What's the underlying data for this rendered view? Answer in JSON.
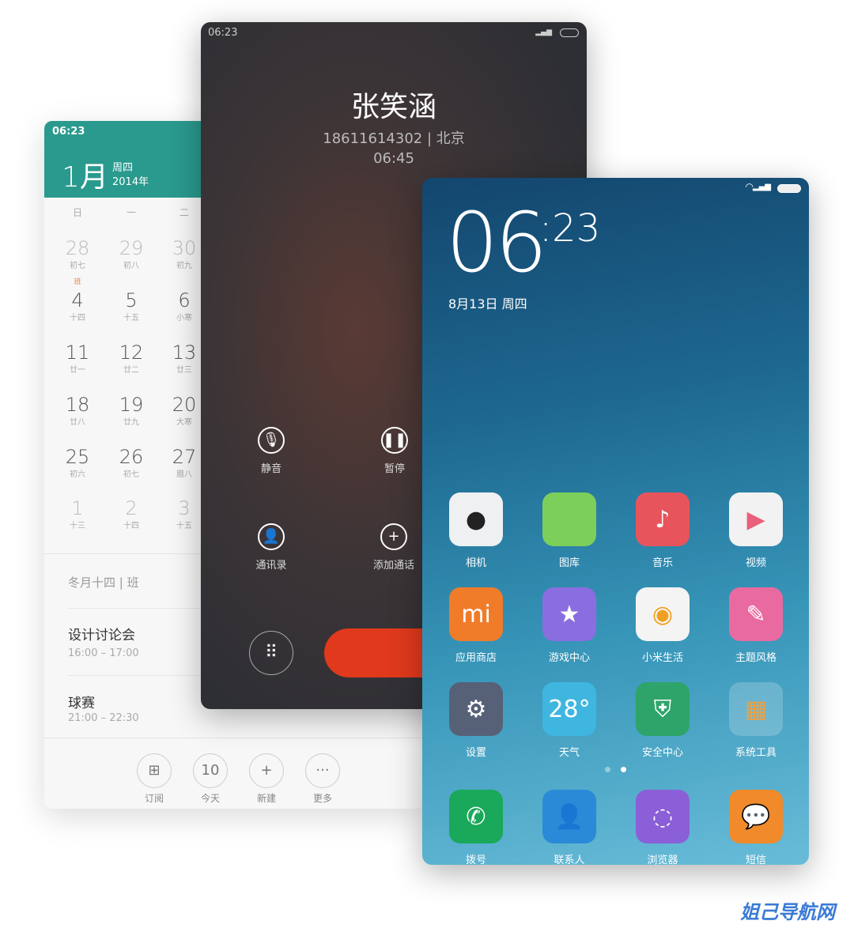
{
  "calendar": {
    "status_time": "06:23",
    "month": "1月",
    "weekday": "周四",
    "year": "2014年",
    "weekdays": [
      "日",
      "一",
      "二"
    ],
    "rows": [
      [
        {
          "d": "28",
          "l": "初七",
          "dim": true
        },
        {
          "d": "29",
          "l": "初八",
          "dim": true
        },
        {
          "d": "30",
          "l": "初九",
          "dim": true
        }
      ],
      [
        {
          "d": "4",
          "l": "十四",
          "badge": "班"
        },
        {
          "d": "5",
          "l": "十五"
        },
        {
          "d": "6",
          "l": "小寒"
        }
      ],
      [
        {
          "d": "11",
          "l": "廿一"
        },
        {
          "d": "12",
          "l": "廿二"
        },
        {
          "d": "13",
          "l": "廿三"
        }
      ],
      [
        {
          "d": "18",
          "l": "廿八"
        },
        {
          "d": "19",
          "l": "廿九"
        },
        {
          "d": "20",
          "l": "大寒"
        }
      ],
      [
        {
          "d": "25",
          "l": "初六"
        },
        {
          "d": "26",
          "l": "初七"
        },
        {
          "d": "27",
          "l": "腊八"
        }
      ],
      [
        {
          "d": "1",
          "l": "十三",
          "dim": true
        },
        {
          "d": "2",
          "l": "十四",
          "dim": true
        },
        {
          "d": "3",
          "l": "十五",
          "dim": true
        }
      ]
    ],
    "lunar_info": "冬月十四 | 班",
    "events": [
      {
        "title": "设计讨论会",
        "time": "16:00 – 17:00"
      },
      {
        "title": "球赛",
        "time": "21:00 – 22:30"
      }
    ],
    "toolbar": [
      {
        "icon": "grid-icon",
        "glyph": "⊞",
        "label": "订阅"
      },
      {
        "icon": "today-icon",
        "glyph": "10",
        "label": "今天"
      },
      {
        "icon": "plus-icon",
        "glyph": "+",
        "label": "新建"
      },
      {
        "icon": "more-icon",
        "glyph": "···",
        "label": "更多"
      }
    ]
  },
  "call": {
    "status_time": "06:23",
    "name": "张笑涵",
    "number_location": "18611614302 | 北京",
    "duration": "06:45",
    "buttons": [
      {
        "icon": "microphone-icon",
        "glyph": "🎙",
        "label": "静音"
      },
      {
        "icon": "pause-icon",
        "glyph": "❚❚",
        "label": "暂停"
      },
      {
        "icon": "contact-icon",
        "glyph": "👤",
        "label": "通讯录"
      },
      {
        "icon": "add-call-icon",
        "glyph": "+",
        "label": "添加通话"
      }
    ],
    "end_color": "#e0391c"
  },
  "home": {
    "clock_hour": "06",
    "clock_minute": ":23",
    "date": "8月13日 周四",
    "apps": [
      {
        "label": "相机",
        "icon": "camera-icon",
        "bg": "#eef0f2",
        "glyph": "●",
        "fg": "#222"
      },
      {
        "label": "图库",
        "icon": "gallery-icon",
        "bg": "#7ccf5a",
        "glyph": "",
        "fg": "#fff"
      },
      {
        "label": "音乐",
        "icon": "music-icon",
        "bg": "#e8545c",
        "glyph": "♪",
        "fg": "#fff"
      },
      {
        "label": "视频",
        "icon": "video-icon",
        "bg": "#f2f2f2",
        "glyph": "▶",
        "fg": "#e9607a"
      },
      {
        "label": "应用商店",
        "icon": "app-store-icon",
        "bg": "#f07c2a",
        "glyph": "mi",
        "fg": "#fff"
      },
      {
        "label": "游戏中心",
        "icon": "game-center-icon",
        "bg": "#8a6ee0",
        "glyph": "★",
        "fg": "#fff"
      },
      {
        "label": "小米生活",
        "icon": "mi-life-icon",
        "bg": "#f4f4f4",
        "glyph": "◉",
        "fg": "#f0a020"
      },
      {
        "label": "主题风格",
        "icon": "theme-icon",
        "bg": "#e96aa0",
        "glyph": "✎",
        "fg": "#fff"
      },
      {
        "label": "设置",
        "icon": "settings-icon",
        "bg": "#566178",
        "glyph": "⚙",
        "fg": "#fff"
      },
      {
        "label": "天气",
        "icon": "weather-icon",
        "bg": "#3fb6e0",
        "glyph": "28°",
        "fg": "#fff"
      },
      {
        "label": "安全中心",
        "icon": "security-icon",
        "bg": "#2ea46a",
        "glyph": "⛨",
        "fg": "#fff"
      },
      {
        "label": "系统工具",
        "icon": "system-tools-folder-icon",
        "bg": "rgba(255,255,255,0.2)",
        "glyph": "▦",
        "fg": "#f0a040"
      }
    ],
    "dock": [
      {
        "label": "拨号",
        "icon": "phone-icon",
        "bg": "#1aa85a",
        "glyph": "✆",
        "fg": "#fff"
      },
      {
        "label": "联系人",
        "icon": "contacts-icon",
        "bg": "#2a8ad8",
        "glyph": "👤",
        "fg": "#fff"
      },
      {
        "label": "浏览器",
        "icon": "browser-icon",
        "bg": "#8b5fd8",
        "glyph": "◌",
        "fg": "#fff"
      },
      {
        "label": "短信",
        "icon": "messages-icon",
        "bg": "#f08a2a",
        "glyph": "💬",
        "fg": "#fff"
      }
    ],
    "page_count": 2,
    "active_page": 2
  },
  "watermark": "姐己导航网"
}
